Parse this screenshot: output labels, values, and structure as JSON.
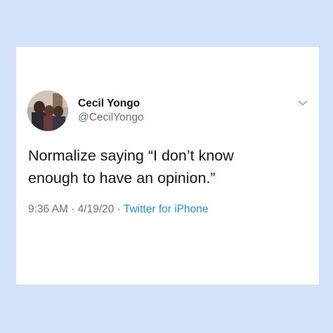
{
  "tweet": {
    "author": {
      "display_name": "Cecil Yongo",
      "handle": "@CecilYongo",
      "avatar_icon": "profile-photo"
    },
    "menu_icon": "chevron-down-icon",
    "text_lines": [
      "Normalize saying “I don’t know",
      "enough to have an opinion.”"
    ],
    "meta": {
      "time": "9:36 AM",
      "separator": " · ",
      "date": "4/19/20",
      "source": "Twitter for iPhone"
    }
  },
  "colors": {
    "background": "#d2e2fb",
    "card": "#ffffff",
    "text": "#14171a",
    "secondary": "#657786",
    "link": "#1b95e0"
  }
}
